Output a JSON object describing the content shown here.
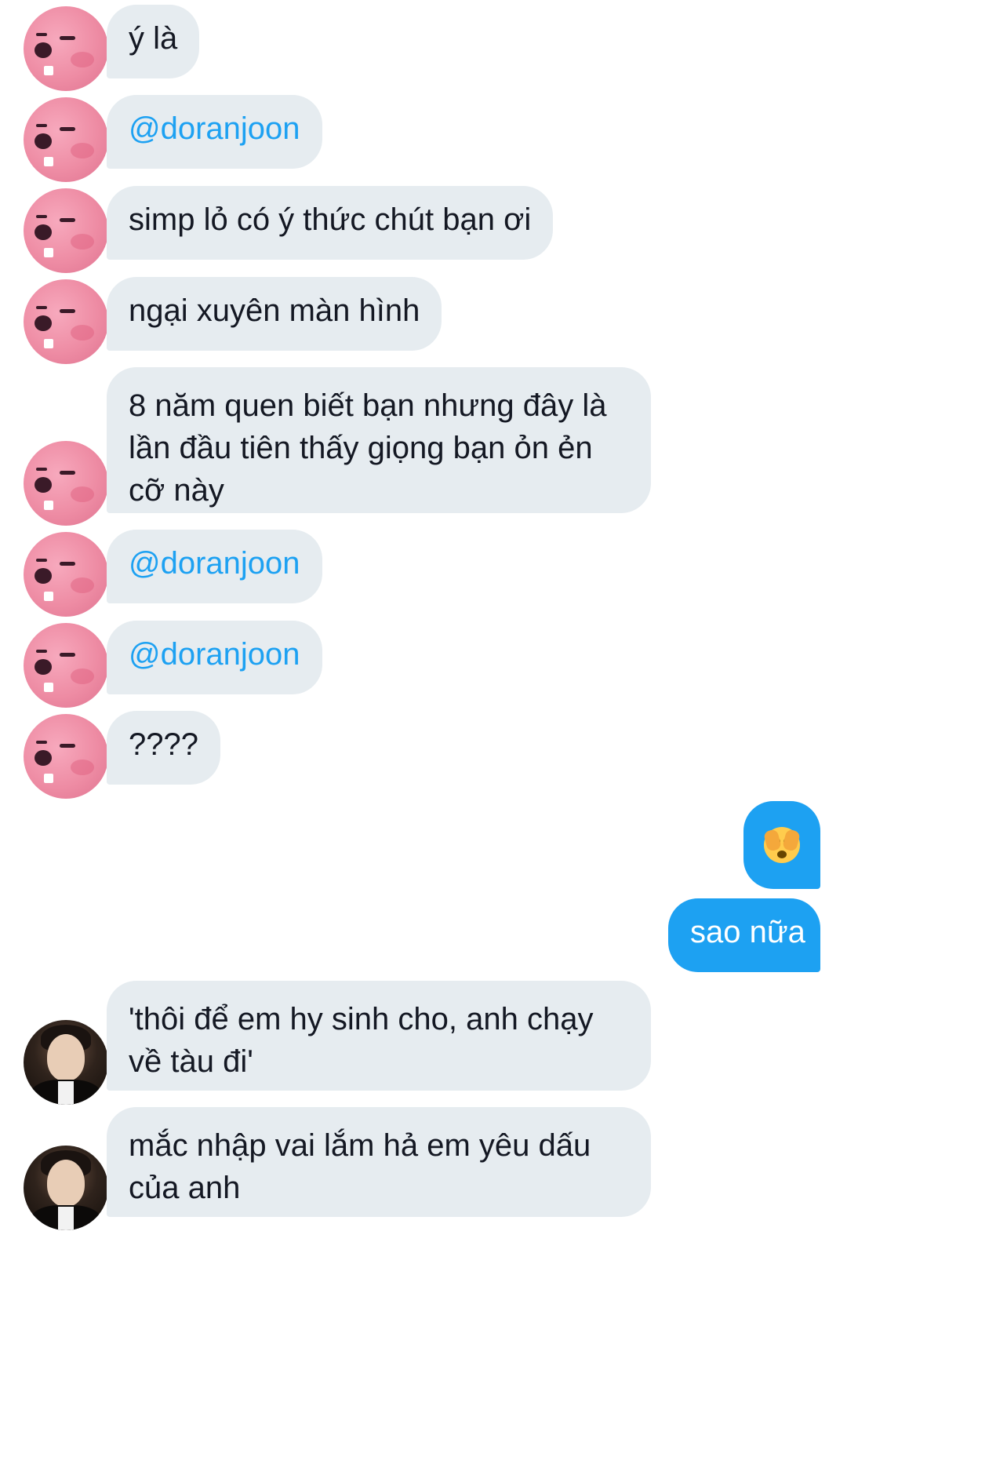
{
  "messages": [
    {
      "sender": "other",
      "avatar": "pink-creature-avatar",
      "text": "ý là"
    },
    {
      "sender": "other",
      "avatar": "pink-creature-avatar",
      "text": "@doranjoon",
      "is_mention": true
    },
    {
      "sender": "other",
      "avatar": "pink-creature-avatar",
      "text": "simp lỏ có ý thức chút bạn ơi"
    },
    {
      "sender": "other",
      "avatar": "pink-creature-avatar",
      "text": "ngại xuyên màn hình"
    },
    {
      "sender": "other",
      "avatar": "pink-creature-avatar",
      "text": "8 năm quen biết bạn nhưng đây là lần đầu tiên thấy giọng bạn ỏn ẻn cỡ này"
    },
    {
      "sender": "other",
      "avatar": "pink-creature-avatar",
      "text": "@doranjoon",
      "is_mention": true
    },
    {
      "sender": "other",
      "avatar": "pink-creature-avatar",
      "text": "@doranjoon",
      "is_mention": true
    },
    {
      "sender": "other",
      "avatar": "pink-creature-avatar",
      "text": "????"
    },
    {
      "sender": "me",
      "emoji": "face-with-hand-over-eyes-emoji"
    },
    {
      "sender": "me",
      "text": "sao nữa"
    },
    {
      "sender": "other2",
      "avatar": "man-in-suit-avatar",
      "text": "'thôi để em hy sinh cho, anh chạy về tàu đi'"
    },
    {
      "sender": "other2",
      "avatar": "man-in-suit-avatar",
      "text": "mắc nhập vai lắm hả em yêu dấu của anh"
    }
  ],
  "colors": {
    "received_bubble": "#e6ecf0",
    "sent_bubble": "#1da1f2",
    "mention": "#1da1f2",
    "text": "#141823"
  }
}
